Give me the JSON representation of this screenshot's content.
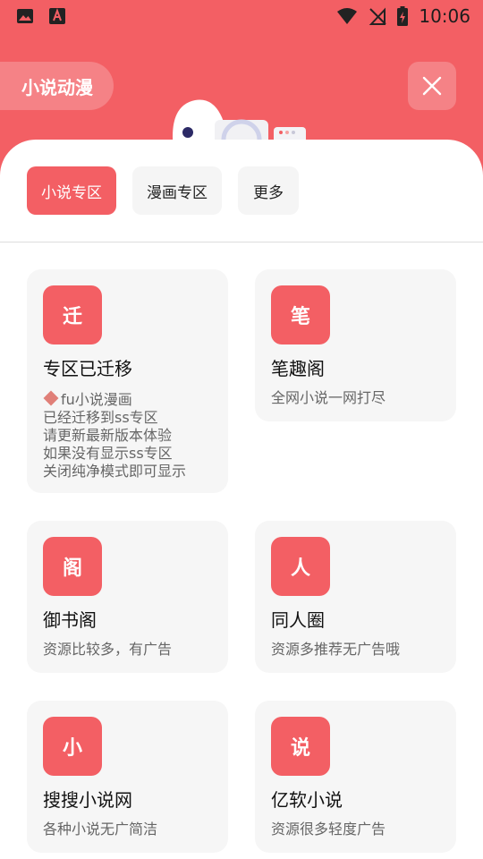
{
  "status_bar": {
    "time": "10:06"
  },
  "header": {
    "title": "小说动漫"
  },
  "tabs": [
    {
      "label": "小说专区",
      "active": true
    },
    {
      "label": "漫画专区",
      "active": false
    },
    {
      "label": "更多",
      "active": false
    }
  ],
  "cards": [
    {
      "icon_char": "迁",
      "title": "专区已迁移",
      "desc_lines": [
        "fu小说漫画",
        "已经迁移到ss专区",
        "请更新最新版本体验",
        "如果没有显示ss专区",
        "关闭纯净模式即可显示"
      ]
    },
    {
      "icon_char": "笔",
      "title": "笔趣阁",
      "desc": "全网小说一网打尽"
    },
    {
      "icon_char": "阁",
      "title": "御书阁",
      "desc": "资源比较多，有广告"
    },
    {
      "icon_char": "人",
      "title": "同人圈",
      "desc": "资源多推荐无广告哦"
    },
    {
      "icon_char": "小",
      "title": "搜搜小说网",
      "desc": "各种小说无广简洁"
    },
    {
      "icon_char": "说",
      "title": "亿软小说",
      "desc": "资源很多轻度广告"
    }
  ],
  "colors": {
    "accent": "#f35f64",
    "card_bg": "#f6f6f6",
    "tab_bg": "#f5f5f5"
  }
}
